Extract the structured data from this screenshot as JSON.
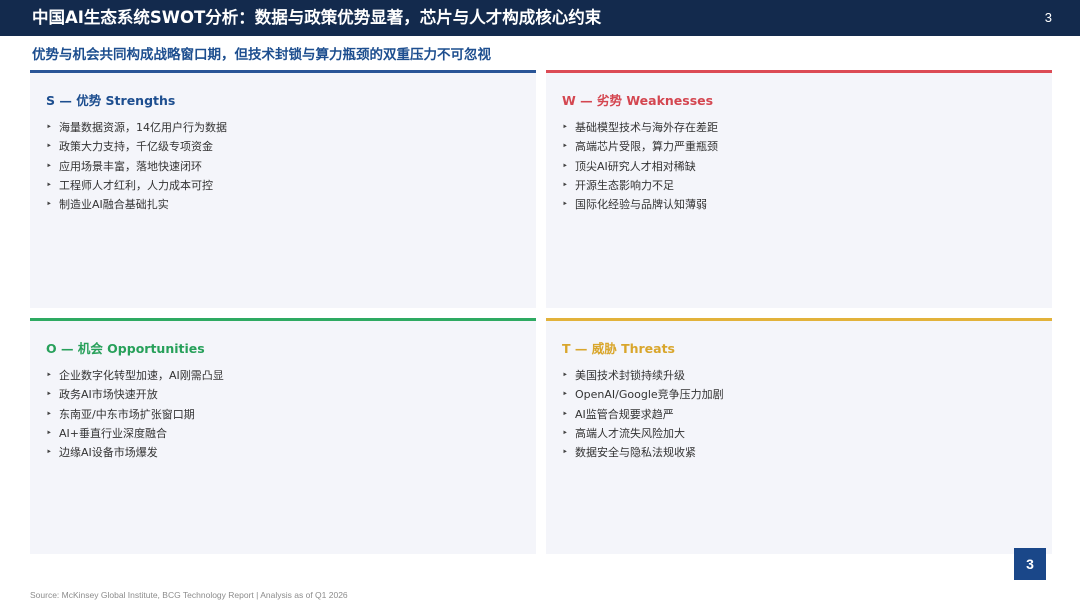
{
  "header": {
    "title": "中国AI生态系统SWOT分析：数据与政策优势显著，芯片与人才构成核心约束",
    "page_number": "3"
  },
  "subtitle": "优势与机会共同构成战略窗口期，但技术封锁与算力瓶颈的双重压力不可忽视",
  "swot": {
    "strengths": {
      "title": "S — 优势 Strengths",
      "accent_color": "#2a5597",
      "items": [
        "海量数据资源，14亿用户行为数据",
        "政策大力支持，千亿级专项资金",
        "应用场景丰富，落地快速闭环",
        "工程师人才红利，人力成本可控",
        "制造业AI融合基础扎实"
      ]
    },
    "weaknesses": {
      "title": "W — 劣势 Weaknesses",
      "accent_color": "#dc4b55",
      "items": [
        "基础模型技术与海外存在差距",
        "高端芯片受限，算力严重瓶颈",
        "顶尖AI研究人才相对稀缺",
        "开源生态影响力不足",
        "国际化经验与品牌认知薄弱"
      ]
    },
    "opportunities": {
      "title": "O — 机会 Opportunities",
      "accent_color": "#2eaa62",
      "items": [
        "企业数字化转型加速，AI刚需凸显",
        "政务AI市场快速开放",
        "东南亚/中东市场扩张窗口期",
        "AI+垂直行业深度融合",
        "边缘AI设备市场爆发"
      ]
    },
    "threats": {
      "title": "T — 威胁 Threats",
      "accent_color": "#e2b23a",
      "items": [
        "美国技术封锁持续升级",
        "OpenAI/Google竞争压力加剧",
        "AI监管合规要求趋严",
        "高端人才流失风险加大",
        "数据安全与隐私法规收紧"
      ]
    }
  },
  "page_badge": "3",
  "source": "Source: McKinsey Global Institute, BCG Technology Report | Analysis as of Q1 2026"
}
